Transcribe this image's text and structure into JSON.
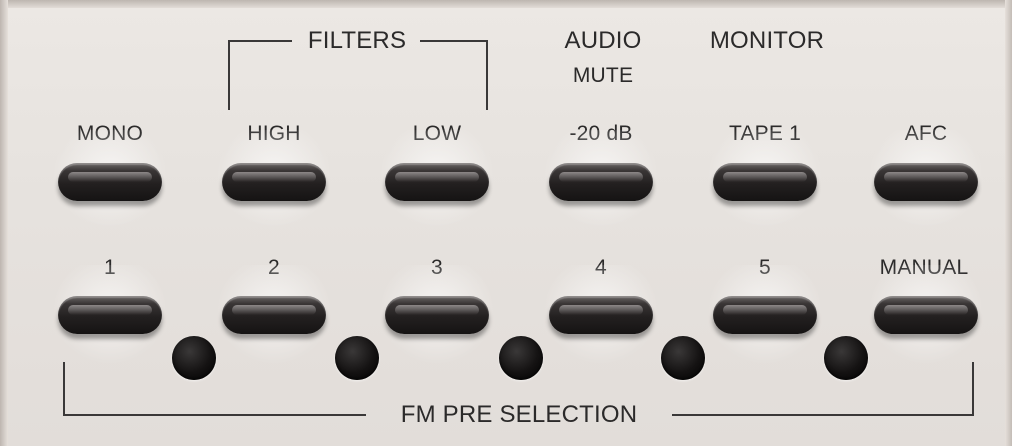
{
  "panel": {
    "groups": {
      "filters": "FILTERS",
      "audio": "AUDIO",
      "mute": "MUTE",
      "monitor": "MONITOR",
      "fm_pre_selection": "FM PRE SELECTION"
    },
    "top_buttons": [
      {
        "label": "MONO"
      },
      {
        "label": "HIGH"
      },
      {
        "label": "LOW"
      },
      {
        "label": "-20 dB"
      },
      {
        "label": "TAPE 1"
      },
      {
        "label": "AFC"
      }
    ],
    "bottom_buttons": [
      {
        "label": "1"
      },
      {
        "label": "2"
      },
      {
        "label": "3"
      },
      {
        "label": "4"
      },
      {
        "label": "5"
      },
      {
        "label": "MANUAL"
      }
    ],
    "indicator_count": 5,
    "colors": {
      "panel": "#e8e4e0",
      "button": "#242121",
      "led": "#0c0b0b",
      "text": "#2b2a2a"
    }
  }
}
